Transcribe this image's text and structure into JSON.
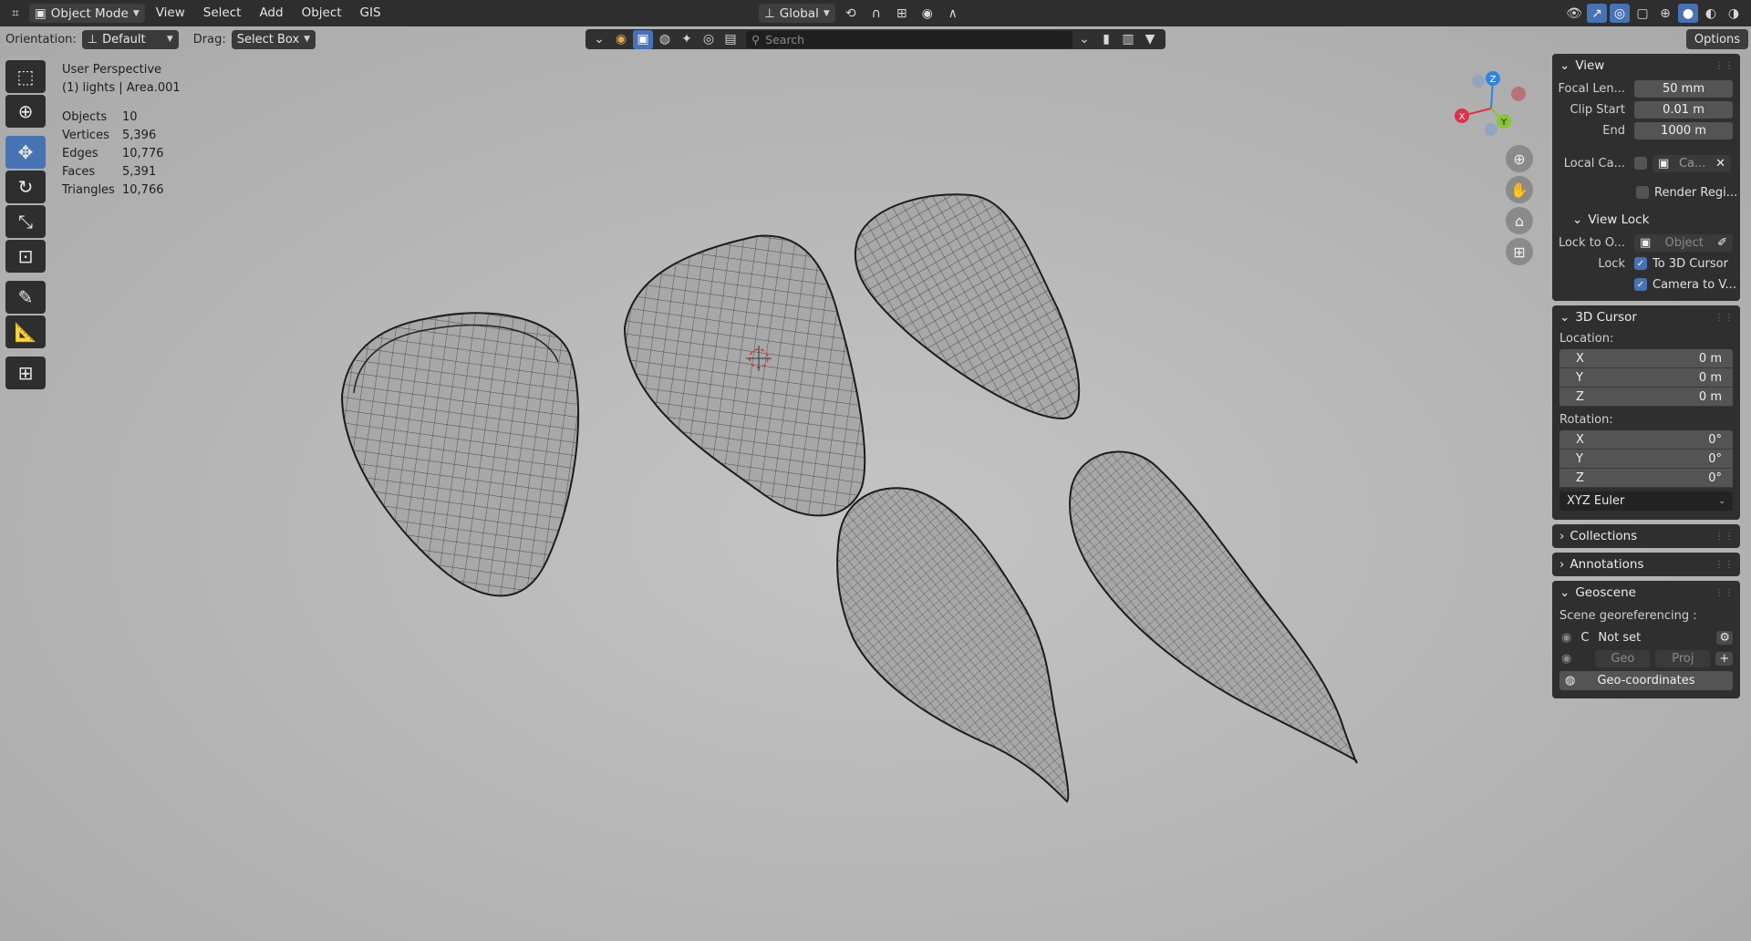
{
  "menubar": {
    "mode": "Object Mode",
    "items": [
      "View",
      "Select",
      "Add",
      "Object",
      "GIS"
    ],
    "transform_orientation": "Global"
  },
  "header": {
    "orientation_label": "Orientation:",
    "orientation_value": "Default",
    "drag_label": "Drag:",
    "drag_value": "Select Box",
    "search_placeholder": "Search",
    "options_label": "Options"
  },
  "overlay": {
    "view_name": "User Perspective",
    "collection_line": "(1) lights | Area.001",
    "stats": [
      {
        "key": "Objects",
        "value": "10"
      },
      {
        "key": "Vertices",
        "value": "5,396"
      },
      {
        "key": "Edges",
        "value": "10,776"
      },
      {
        "key": "Faces",
        "value": "5,391"
      },
      {
        "key": "Triangles",
        "value": "10,766"
      }
    ]
  },
  "gizmo": {
    "x": "X",
    "y": "Y",
    "z": "Z",
    "x_color": "#e0304a",
    "y_color": "#8bc534",
    "z_color": "#2f84e3"
  },
  "npanel": {
    "view": {
      "title": "View",
      "focal_label": "Focal Len...",
      "focal_value": "50 mm",
      "clip_start_label": "Clip Start",
      "clip_start_value": "0.01 m",
      "end_label": "End",
      "end_value": "1000 m",
      "local_cam_label": "Local Ca...",
      "local_cam_value": "Ca...",
      "render_region_label": "Render Regi...",
      "view_lock_title": "View Lock",
      "lock_to_label": "Lock to O...",
      "lock_to_placeholder": "Object",
      "lock_label": "Lock",
      "to_3d_cursor": "To 3D Cursor",
      "camera_to_view": "Camera to V..."
    },
    "cursor": {
      "title": "3D Cursor",
      "location_label": "Location:",
      "location": [
        {
          "axis": "X",
          "value": "0 m"
        },
        {
          "axis": "Y",
          "value": "0 m"
        },
        {
          "axis": "Z",
          "value": "0 m"
        }
      ],
      "rotation_label": "Rotation:",
      "rotation": [
        {
          "axis": "X",
          "value": "0°"
        },
        {
          "axis": "Y",
          "value": "0°"
        },
        {
          "axis": "Z",
          "value": "0°"
        }
      ],
      "rotation_mode": "XYZ Euler"
    },
    "collections_title": "Collections",
    "annotations_title": "Annotations",
    "geoscene": {
      "title": "Geoscene",
      "georef_label": "Scene georeferencing :",
      "c_label": "C",
      "not_set": "Not set",
      "geo_label": "Geo",
      "proj_label": "Proj",
      "geo_coords_label": "Geo-coordinates"
    }
  },
  "colors": {
    "accent": "#4772b3",
    "panel_bg": "#2f2f2f",
    "viewport_bg": "#bdbdbd"
  }
}
